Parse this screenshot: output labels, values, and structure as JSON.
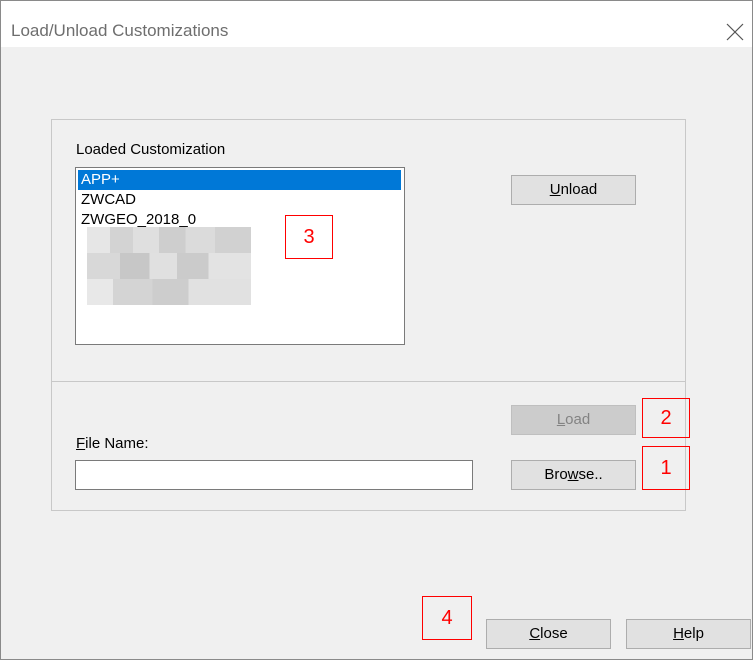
{
  "window": {
    "title": "Load/Unload Customizations",
    "close_icon": "close-icon"
  },
  "loaded_section": {
    "label": "Loaded Customization",
    "items": [
      {
        "label": "APP+",
        "selected": true
      },
      {
        "label": "ZWCAD",
        "selected": false
      },
      {
        "label": "ZWGEO_2018_0",
        "selected": false
      }
    ]
  },
  "buttons": {
    "unload": {
      "before": "",
      "mnemonic": "U",
      "after": "nload"
    },
    "load": {
      "before": "",
      "mnemonic": "L",
      "after": "oad",
      "disabled": true
    },
    "browse": {
      "before": "Bro",
      "mnemonic": "w",
      "after": "se.."
    },
    "close": {
      "before": "",
      "mnemonic": "C",
      "after": "lose"
    },
    "help": {
      "before": "",
      "mnemonic": "H",
      "after": "elp"
    }
  },
  "file_name": {
    "label_mnemonic": "F",
    "label_rest": "ile Name:",
    "value": ""
  },
  "markers": [
    "1",
    "2",
    "3",
    "4"
  ]
}
